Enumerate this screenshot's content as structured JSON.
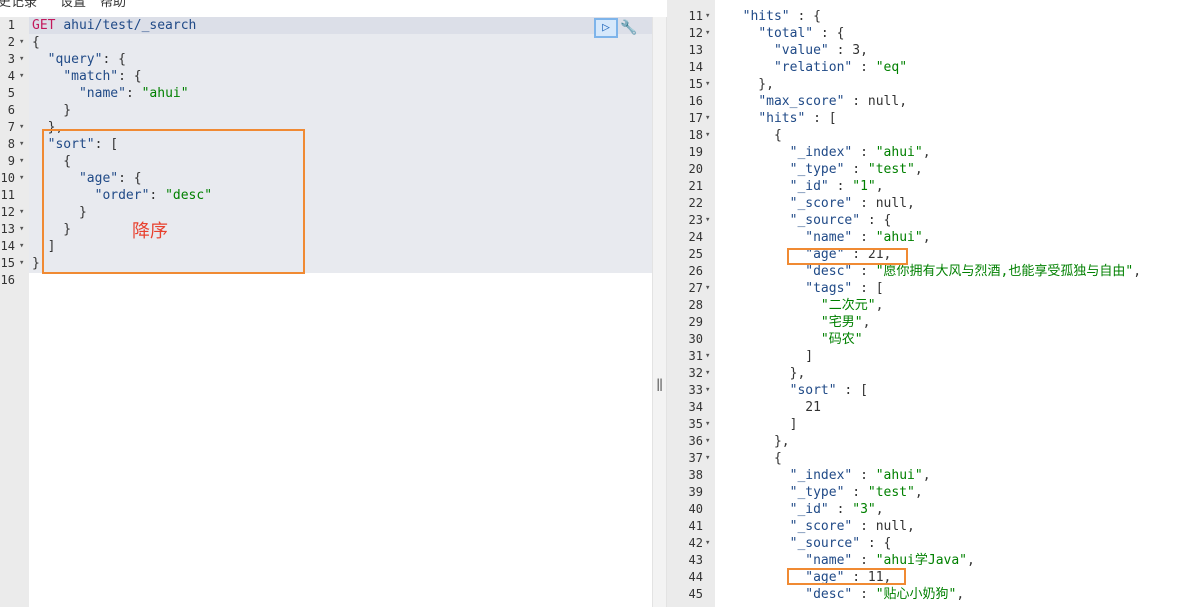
{
  "menubar": [
    "史记录",
    "设置",
    "帮助"
  ],
  "request": {
    "lines": [
      {
        "n": "1",
        "fold": false,
        "segs": [
          [
            "GET ",
            "m"
          ],
          [
            "ahui/test/_search",
            "k"
          ]
        ]
      },
      {
        "n": "2",
        "fold": true,
        "segs": [
          [
            "{",
            "p"
          ]
        ]
      },
      {
        "n": "3",
        "fold": true,
        "segs": [
          [
            "  ",
            "p"
          ],
          [
            "\"query\"",
            "k"
          ],
          [
            ": {",
            "p"
          ]
        ]
      },
      {
        "n": "4",
        "fold": true,
        "segs": [
          [
            "    ",
            "p"
          ],
          [
            "\"match\"",
            "k"
          ],
          [
            ": {",
            "p"
          ]
        ]
      },
      {
        "n": "5",
        "fold": false,
        "segs": [
          [
            "      ",
            "p"
          ],
          [
            "\"name\"",
            "k"
          ],
          [
            ": ",
            "p"
          ],
          [
            "\"ahui\"",
            "s"
          ]
        ]
      },
      {
        "n": "6",
        "fold": false,
        "segs": [
          [
            "    }",
            "p"
          ]
        ]
      },
      {
        "n": "7",
        "fold": true,
        "segs": [
          [
            "  },",
            "p"
          ]
        ]
      },
      {
        "n": "8",
        "fold": true,
        "segs": [
          [
            "  ",
            "p"
          ],
          [
            "\"sort\"",
            "k"
          ],
          [
            ": [",
            "p"
          ]
        ]
      },
      {
        "n": "9",
        "fold": true,
        "segs": [
          [
            "    {",
            "p"
          ]
        ]
      },
      {
        "n": "10",
        "fold": true,
        "segs": [
          [
            "      ",
            "p"
          ],
          [
            "\"age\"",
            "k"
          ],
          [
            ": {",
            "p"
          ]
        ]
      },
      {
        "n": "11",
        "fold": false,
        "segs": [
          [
            "        ",
            "p"
          ],
          [
            "\"order\"",
            "k"
          ],
          [
            ": ",
            "p"
          ],
          [
            "\"desc\"",
            "s"
          ]
        ]
      },
      {
        "n": "12",
        "fold": true,
        "segs": [
          [
            "      }",
            "p"
          ]
        ]
      },
      {
        "n": "13",
        "fold": true,
        "segs": [
          [
            "    }",
            "p"
          ]
        ]
      },
      {
        "n": "14",
        "fold": true,
        "segs": [
          [
            "  ]",
            "p"
          ]
        ]
      },
      {
        "n": "15",
        "fold": true,
        "segs": [
          [
            "}",
            "p"
          ]
        ]
      },
      {
        "n": "16",
        "fold": false,
        "segs": []
      }
    ],
    "run_icon": "play-icon",
    "wrench_icon": "wrench-icon"
  },
  "annotation": {
    "label": "降序",
    "box_color": "#f08a33",
    "label_color": "#e8412f"
  },
  "response": {
    "lines": [
      {
        "n": "11",
        "fold": true,
        "segs": [
          [
            "  ",
            "p"
          ],
          [
            "\"hits\"",
            "k"
          ],
          [
            " : {",
            "p"
          ]
        ]
      },
      {
        "n": "12",
        "fold": true,
        "segs": [
          [
            "    ",
            "p"
          ],
          [
            "\"total\"",
            "k"
          ],
          [
            " : {",
            "p"
          ]
        ]
      },
      {
        "n": "13",
        "fold": false,
        "segs": [
          [
            "      ",
            "p"
          ],
          [
            "\"value\"",
            "k"
          ],
          [
            " : 3,",
            "p"
          ]
        ]
      },
      {
        "n": "14",
        "fold": false,
        "segs": [
          [
            "      ",
            "p"
          ],
          [
            "\"relation\"",
            "k"
          ],
          [
            " : ",
            "p"
          ],
          [
            "\"eq\"",
            "s"
          ]
        ]
      },
      {
        "n": "15",
        "fold": true,
        "segs": [
          [
            "    },",
            "p"
          ]
        ]
      },
      {
        "n": "16",
        "fold": false,
        "segs": [
          [
            "    ",
            "p"
          ],
          [
            "\"max_score\"",
            "k"
          ],
          [
            " : null,",
            "p"
          ]
        ]
      },
      {
        "n": "17",
        "fold": true,
        "segs": [
          [
            "    ",
            "p"
          ],
          [
            "\"hits\"",
            "k"
          ],
          [
            " : [",
            "p"
          ]
        ]
      },
      {
        "n": "18",
        "fold": true,
        "segs": [
          [
            "      {",
            "p"
          ]
        ]
      },
      {
        "n": "19",
        "fold": false,
        "segs": [
          [
            "        ",
            "p"
          ],
          [
            "\"_index\"",
            "k"
          ],
          [
            " : ",
            "p"
          ],
          [
            "\"ahui\"",
            "s"
          ],
          [
            ",",
            "p"
          ]
        ]
      },
      {
        "n": "20",
        "fold": false,
        "segs": [
          [
            "        ",
            "p"
          ],
          [
            "\"_type\"",
            "k"
          ],
          [
            " : ",
            "p"
          ],
          [
            "\"test\"",
            "s"
          ],
          [
            ",",
            "p"
          ]
        ]
      },
      {
        "n": "21",
        "fold": false,
        "segs": [
          [
            "        ",
            "p"
          ],
          [
            "\"_id\"",
            "k"
          ],
          [
            " : ",
            "p"
          ],
          [
            "\"1\"",
            "s"
          ],
          [
            ",",
            "p"
          ]
        ]
      },
      {
        "n": "22",
        "fold": false,
        "segs": [
          [
            "        ",
            "p"
          ],
          [
            "\"_score\"",
            "k"
          ],
          [
            " : null,",
            "p"
          ]
        ]
      },
      {
        "n": "23",
        "fold": true,
        "segs": [
          [
            "        ",
            "p"
          ],
          [
            "\"_source\"",
            "k"
          ],
          [
            " : {",
            "p"
          ]
        ]
      },
      {
        "n": "24",
        "fold": false,
        "segs": [
          [
            "          ",
            "p"
          ],
          [
            "\"name\"",
            "k"
          ],
          [
            " : ",
            "p"
          ],
          [
            "\"ahui\"",
            "s"
          ],
          [
            ",",
            "p"
          ]
        ]
      },
      {
        "n": "25",
        "fold": false,
        "segs": [
          [
            "          ",
            "p"
          ],
          [
            "\"age\"",
            "k"
          ],
          [
            " : 21,",
            "p"
          ]
        ]
      },
      {
        "n": "26",
        "fold": false,
        "segs": [
          [
            "          ",
            "p"
          ],
          [
            "\"desc\"",
            "k"
          ],
          [
            " : ",
            "p"
          ],
          [
            "\"愿你拥有大风与烈酒,也能享受孤独与自由\"",
            "s"
          ],
          [
            ",",
            "p"
          ]
        ]
      },
      {
        "n": "27",
        "fold": true,
        "segs": [
          [
            "          ",
            "p"
          ],
          [
            "\"tags\"",
            "k"
          ],
          [
            " : [",
            "p"
          ]
        ]
      },
      {
        "n": "28",
        "fold": false,
        "segs": [
          [
            "            ",
            "p"
          ],
          [
            "\"二次元\"",
            "s"
          ],
          [
            ",",
            "p"
          ]
        ]
      },
      {
        "n": "29",
        "fold": false,
        "segs": [
          [
            "            ",
            "p"
          ],
          [
            "\"宅男\"",
            "s"
          ],
          [
            ",",
            "p"
          ]
        ]
      },
      {
        "n": "30",
        "fold": false,
        "segs": [
          [
            "            ",
            "p"
          ],
          [
            "\"码农\"",
            "s"
          ]
        ]
      },
      {
        "n": "31",
        "fold": true,
        "segs": [
          [
            "          ]",
            "p"
          ]
        ]
      },
      {
        "n": "32",
        "fold": true,
        "segs": [
          [
            "        },",
            "p"
          ]
        ]
      },
      {
        "n": "33",
        "fold": true,
        "segs": [
          [
            "        ",
            "p"
          ],
          [
            "\"sort\"",
            "k"
          ],
          [
            " : [",
            "p"
          ]
        ]
      },
      {
        "n": "34",
        "fold": false,
        "segs": [
          [
            "          21",
            "p"
          ]
        ]
      },
      {
        "n": "35",
        "fold": true,
        "segs": [
          [
            "        ]",
            "p"
          ]
        ]
      },
      {
        "n": "36",
        "fold": true,
        "segs": [
          [
            "      },",
            "p"
          ]
        ]
      },
      {
        "n": "37",
        "fold": true,
        "segs": [
          [
            "      {",
            "p"
          ]
        ]
      },
      {
        "n": "38",
        "fold": false,
        "segs": [
          [
            "        ",
            "p"
          ],
          [
            "\"_index\"",
            "k"
          ],
          [
            " : ",
            "p"
          ],
          [
            "\"ahui\"",
            "s"
          ],
          [
            ",",
            "p"
          ]
        ]
      },
      {
        "n": "39",
        "fold": false,
        "segs": [
          [
            "        ",
            "p"
          ],
          [
            "\"_type\"",
            "k"
          ],
          [
            " : ",
            "p"
          ],
          [
            "\"test\"",
            "s"
          ],
          [
            ",",
            "p"
          ]
        ]
      },
      {
        "n": "40",
        "fold": false,
        "segs": [
          [
            "        ",
            "p"
          ],
          [
            "\"_id\"",
            "k"
          ],
          [
            " : ",
            "p"
          ],
          [
            "\"3\"",
            "s"
          ],
          [
            ",",
            "p"
          ]
        ]
      },
      {
        "n": "41",
        "fold": false,
        "segs": [
          [
            "        ",
            "p"
          ],
          [
            "\"_score\"",
            "k"
          ],
          [
            " : null,",
            "p"
          ]
        ]
      },
      {
        "n": "42",
        "fold": true,
        "segs": [
          [
            "        ",
            "p"
          ],
          [
            "\"_source\"",
            "k"
          ],
          [
            " : {",
            "p"
          ]
        ]
      },
      {
        "n": "43",
        "fold": false,
        "segs": [
          [
            "          ",
            "p"
          ],
          [
            "\"name\"",
            "k"
          ],
          [
            " : ",
            "p"
          ],
          [
            "\"ahui学Java\"",
            "s"
          ],
          [
            ",",
            "p"
          ]
        ]
      },
      {
        "n": "44",
        "fold": false,
        "segs": [
          [
            "          ",
            "p"
          ],
          [
            "\"age\"",
            "k"
          ],
          [
            " : 11,",
            "p"
          ]
        ]
      },
      {
        "n": "45",
        "fold": false,
        "segs": [
          [
            "          ",
            "p"
          ],
          [
            "\"desc\"",
            "k"
          ],
          [
            " : ",
            "p"
          ],
          [
            "\"贴心小奶狗\"",
            "s"
          ],
          [
            ",",
            "p"
          ]
        ]
      }
    ]
  },
  "splitter_icon": "double-bar-icon",
  "fold_icon": "fold-arrow-icon"
}
